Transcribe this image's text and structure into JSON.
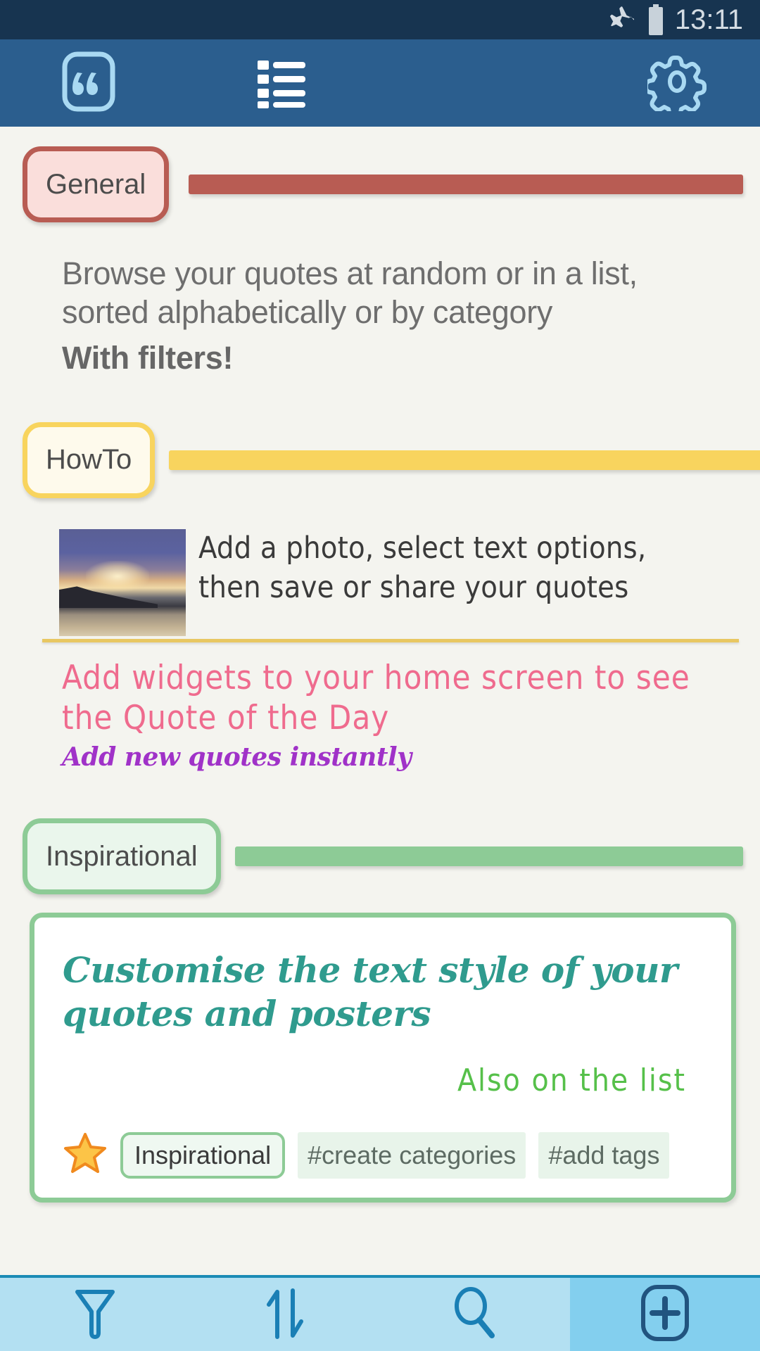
{
  "statusbar": {
    "time": "13:11",
    "airplane_icon": "airplane-mode-icon",
    "battery_icon": "battery-full-icon"
  },
  "appbar": {
    "quote_tab_icon": "quote-mark-icon",
    "list_tab_icon": "list-view-icon",
    "settings_icon": "gear-icon",
    "background_color": "#2b5e8e"
  },
  "sections": {
    "general": {
      "label": "General",
      "border_color": "#b85c53",
      "fill_color": "#fadedb",
      "body_line1": "Browse your quotes at random or in a list,",
      "body_line2": "sorted alphabetically or by category",
      "body_bold": "With filters!"
    },
    "howto": {
      "label": "HowTo",
      "border_color": "#f8d45e",
      "fill_color": "#fefaec",
      "photo_caption_line1": "Add a photo, select text options,",
      "photo_caption_line2": "then save or share your quotes",
      "photo_alt": "sunset-over-water-photo",
      "pink_note_line1": "Add widgets to your home screen to see",
      "pink_note_line2": "the Quote of the Day",
      "pink_color": "#ef6b8e",
      "purple_note": "Add new quotes instantly",
      "purple_color": "#a032c8"
    },
    "inspirational": {
      "label": "Inspirational",
      "border_color": "#8dcb96",
      "fill_color": "#eaf6ec"
    }
  },
  "quote_card": {
    "main_line1": "Customise the text style of your",
    "main_line2": "quotes and posters",
    "main_color": "#2f9b8e",
    "sub_text": "Also on the list",
    "sub_color": "#56c04a",
    "favourite_icon": "star-icon",
    "category_pill": "Inspirational",
    "tags": [
      "#create categories",
      "#add tags"
    ]
  },
  "bottombar": {
    "filter_icon": "filter-funnel-icon",
    "sort_icon": "sort-arrows-icon",
    "search_icon": "search-magnifier-icon",
    "add_icon": "add-plus-icon"
  }
}
